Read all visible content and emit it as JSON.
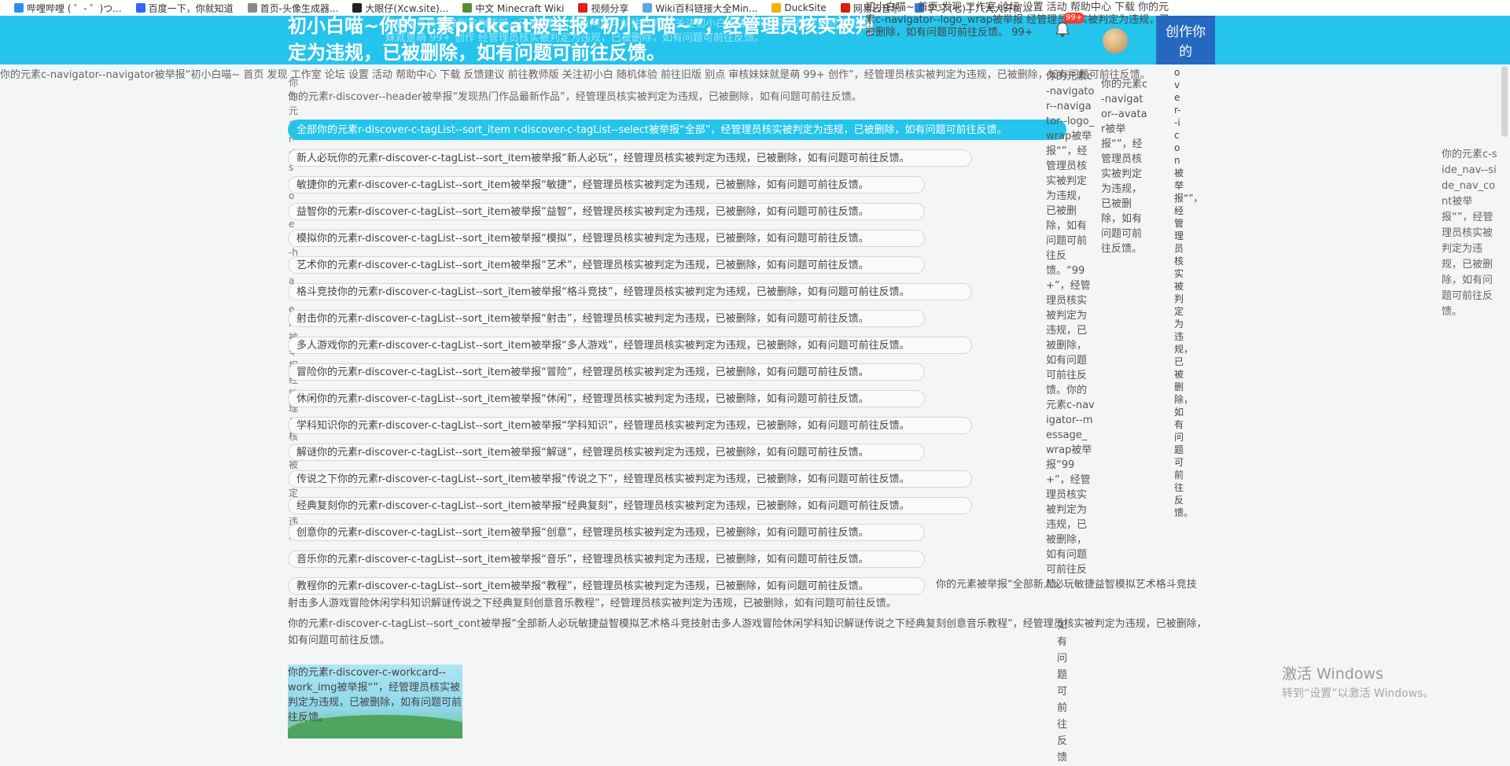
{
  "bookmarks": [
    {
      "label": "哔哩哔哩 ( ゜- ゜)つ...",
      "color": "#2d8cf0"
    },
    {
      "label": "百度一下，你就知道",
      "color": "#3366ff"
    },
    {
      "label": "首页-头像生成器...",
      "color": "#888888"
    },
    {
      "label": "大眼仔(Xcw.site)...",
      "color": "#222222"
    },
    {
      "label": "中文 Minecraft Wiki",
      "color": "#5b8c32"
    },
    {
      "label": "视频分享",
      "color": "#e02020"
    },
    {
      "label": "Wiki百科链接大全Min...",
      "color": "#5aa9e6"
    },
    {
      "label": "DuckSite",
      "color": "#f0b400"
    },
    {
      "label": "网易云音乐",
      "color": "#d81e06"
    },
    {
      "label": "学习 (七)了八大大开贸...",
      "color": "#3a7bd5"
    }
  ],
  "header": {
    "title": "初小白喵~你的元素pickcat被举报“初小白喵~”，经管理员核实被判定为违规，已被删除，如有问题可前往反馈。",
    "noise": "经管理员核实被判定为违规，已被删除，如有问题可前往教师版 关注初小白 随机体验 前往旧版 别点 审核妹妹就是萌 99+ 创作 经管理员核实被判定为违规，已被删除，如有问题可前往反馈。",
    "nav_links": "初小白喵~ 首页 发现 工作室 论坛 设置 活动 帮助中心 下载 你的元素c-navigator--logo_wrap被举报 经管理员核实被判定为违规，已被删除，如有问题可前往反馈。 99+",
    "badge": "99+",
    "create_button": "创作你的"
  },
  "strip": {
    "line1": "你的元素c-navigator--navigator被举报“初小白喵~ 首页 发现 工作室 论坛 设置 活动 帮助中心 下载 反馈建议 前往教师版 关注初小白 随机体验 前往旧版 别点 审核妹妹就是萌 99+ 创作”，经管理员核实被判定为违规，已被删除，如有问题可前往反馈。",
    "line2": "你的元素r-discover--header被举报“发现热门作品最新作品”，经管理员核实被判定为违规，已被删除，如有问题可前往反馈。",
    "vertical": "你的元素r-discover--header被举报经管理员核实被判定为违规"
  },
  "tags": [
    "全部你的元素r-discover-c-tagList--sort_item r-discover-c-tagList--select被举报“全部”，经管理员核实被判定为违规，已被删除，如有问题可前往反馈。",
    "新人必玩你的元素r-discover-c-tagList--sort_item被举报“新人必玩”，经管理员核实被判定为违规，已被删除，如有问题可前往反馈。",
    "敏捷你的元素r-discover-c-tagList--sort_item被举报“敏捷”，经管理员核实被判定为违规，已被删除，如有问题可前往反馈。",
    "益智你的元素r-discover-c-tagList--sort_item被举报“益智”，经管理员核实被判定为违规，已被删除，如有问题可前往反馈。",
    "模拟你的元素r-discover-c-tagList--sort_item被举报“模拟”，经管理员核实被判定为违规，已被删除，如有问题可前往反馈。",
    "艺术你的元素r-discover-c-tagList--sort_item被举报“艺术”，经管理员核实被判定为违规，已被删除，如有问题可前往反馈。",
    "格斗竞技你的元素r-discover-c-tagList--sort_item被举报“格斗竞技”，经管理员核实被判定为违规，已被删除，如有问题可前往反馈。",
    "射击你的元素r-discover-c-tagList--sort_item被举报“射击”，经管理员核实被判定为违规，已被删除，如有问题可前往反馈。",
    "多人游戏你的元素r-discover-c-tagList--sort_item被举报“多人游戏”，经管理员核实被判定为违规，已被删除，如有问题可前往反馈。",
    "冒险你的元素r-discover-c-tagList--sort_item被举报“冒险”，经管理员核实被判定为违规，已被删除，如有问题可前往反馈。",
    "休闲你的元素r-discover-c-tagList--sort_item被举报“休闲”，经管理员核实被判定为违规，已被删除，如有问题可前往反馈。",
    "学科知识你的元素r-discover-c-tagList--sort_item被举报“学科知识”，经管理员核实被判定为违规，已被删除，如有问题可前往反馈。",
    "解谜你的元素r-discover-c-tagList--sort_item被举报“解谜”，经管理员核实被判定为违规，已被删除，如有问题可前往反馈。",
    "传说之下你的元素r-discover-c-tagList--sort_item被举报“传说之下”，经管理员核实被判定为违规，已被删除，如有问题可前往反馈。",
    "经典复刻你的元素r-discover-c-tagList--sort_item被举报“经典复刻”，经管理员核实被判定为违规，已被删除，如有问题可前往反馈。",
    "创意你的元素r-discover-c-tagList--sort_item被举报“创意”，经管理员核实被判定为违规，已被删除，如有问题可前往反馈。",
    "音乐你的元素r-discover-c-tagList--sort_item被举报“音乐”，经管理员核实被判定为违规，已被删除，如有问题可前往反馈。",
    "教程你的元素r-discover-c-tagList--sort_item被举报“教程”，经管理员核实被判定为违规，已被删除，如有问题可前往反馈。"
  ],
  "tag_footer": {
    "right": "你的元素被举报“全部新人必玩敏捷益智模拟艺术格斗竞技",
    "line": "射击多人游戏冒险休闲学科知识解谜传说之下经典复刻创意音乐教程”，经管理员核实被判定为违规，已被删除，如有问题可前往反馈。",
    "cont": "你的元素r-discover-c-tagList--sort_cont被举报“全部新人必玩敏捷益智模拟艺术格斗竞技射击多人游戏冒险休闲学科知识解谜传说之下经典复刻创意音乐教程”，经管理员核实被判定为违规，已被删除，如有问题可前往反馈。"
  },
  "work_card": {
    "text": "你的元素r-discover-c-workcard--work_img被举报“”，经管理员核实被判定为违规，已被删除，如有问题可前往反馈。"
  },
  "right_columns": {
    "a": "你的元素c-navigator--navigator--logo_wrap被举报“”，经管理员核实被判定为违规，已被删除，如有问题可前往反馈。“99+”，经管理员核实被判定为违规，已被删除，如有问题可前往反馈。你的元素c-navigator--message_wrap被举报“99+”，经管理员核实被判定为违规，已被删除，如有问题可前往反馈。",
    "b": "你的元素c-navigator--avatar被举报“”，经管理员核实被判定为违规，已被删除，如有问题可前往反馈。",
    "c": "如有问题可前往反馈",
    "d": "over--icon被举报“”，经管理员核实被判定为违规，已被删除，如有问题可前往反馈。"
  },
  "side_note": "你的元素c-side_nav--side_nav_cont被举报“”，经管理员核实被判定为违规，已被删除，如有问题可前往反馈。",
  "windows": {
    "title": "激活 Windows",
    "subtitle": "转到“设置”以激活 Windows。"
  }
}
